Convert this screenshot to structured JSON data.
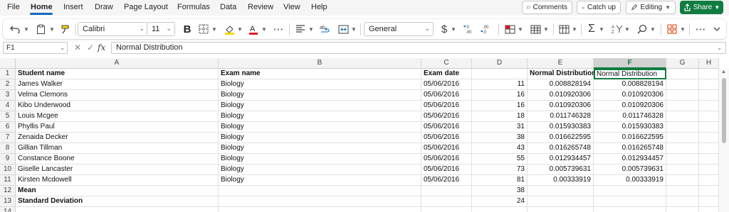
{
  "menu": {
    "items": [
      "File",
      "Home",
      "Insert",
      "Draw",
      "Page Layout",
      "Formulas",
      "Data",
      "Review",
      "View",
      "Help"
    ],
    "active": "Home"
  },
  "top_actions": {
    "comments": "Comments",
    "catch_up": "Catch up",
    "editing": "Editing",
    "share": "Share"
  },
  "ribbon": {
    "font_name": "Calibri",
    "font_size": "11",
    "bold": "B",
    "number_format": "General",
    "currency_symbol": "$",
    "more": "⋯",
    "icons": [
      "undo-icon",
      "paste-icon",
      "format-painter-icon",
      "borders-icon",
      "fill-color-icon",
      "font-color-icon",
      "align-icon",
      "wrap-text-icon",
      "merge-icon",
      "currency-icon",
      "increase-decimal-icon",
      "decrease-decimal-icon",
      "conditional-format-icon",
      "format-as-table-icon",
      "autosum-icon",
      "sort-filter-icon",
      "find-icon",
      "add-ins-icon"
    ],
    "accent_colors": {
      "fill_highlight": "#ffd800",
      "font_color": "#e81123",
      "brand_green": "#107c41"
    }
  },
  "formula_bar": {
    "name_box": "F1",
    "fx": "fx",
    "content": "Normal Distribution"
  },
  "sheet": {
    "columns": [
      "A",
      "B",
      "C",
      "D",
      "E",
      "F",
      "G",
      "H"
    ],
    "selected_column": "F",
    "active_cell": "F1",
    "rows": [
      {
        "n": "1",
        "a": "Student name",
        "b": "Exam name",
        "c": "Exam date",
        "d": "",
        "e": "Normal Distribution",
        "f": "Normal Distribution"
      },
      {
        "n": "2",
        "a": "James Walker",
        "b": "Biology",
        "c": "05/06/2016",
        "d": "11",
        "e": "0.008828194",
        "f": "0.008828194"
      },
      {
        "n": "3",
        "a": "Velma Clemons",
        "b": "Biology",
        "c": "05/06/2016",
        "d": "16",
        "e": "0.010920306",
        "f": "0.010920306"
      },
      {
        "n": "4",
        "a": "Kibo Underwood",
        "b": "Biology",
        "c": "05/06/2016",
        "d": "16",
        "e": "0.010920306",
        "f": "0.010920306"
      },
      {
        "n": "5",
        "a": "Louis Mcgee",
        "b": "Biology",
        "c": "05/06/2016",
        "d": "18",
        "e": "0.011746328",
        "f": "0.011746328"
      },
      {
        "n": "6",
        "a": "Phyllis Paul",
        "b": "Biology",
        "c": "05/06/2016",
        "d": "31",
        "e": "0.015930383",
        "f": "0.015930383"
      },
      {
        "n": "7",
        "a": "Zenaida Decker",
        "b": "Biology",
        "c": "05/06/2016",
        "d": "38",
        "e": "0.016622595",
        "f": "0.016622595"
      },
      {
        "n": "8",
        "a": "Gillian Tillman",
        "b": "Biology",
        "c": "05/06/2016",
        "d": "43",
        "e": "0.016265748",
        "f": "0.016265748"
      },
      {
        "n": "9",
        "a": "Constance Boone",
        "b": "Biology",
        "c": "05/06/2016",
        "d": "55",
        "e": "0.012934457",
        "f": "0.012934457"
      },
      {
        "n": "10",
        "a": "Giselle Lancaster",
        "b": "Biology",
        "c": "05/06/2016",
        "d": "73",
        "e": "0.005739631",
        "f": "0.005739631"
      },
      {
        "n": "11",
        "a": "Kirsten Mcdowell",
        "b": "Biology",
        "c": "05/06/2016",
        "d": "81",
        "e": "0.00333919",
        "f": "0.00333919"
      },
      {
        "n": "12",
        "a": "Mean",
        "b": "",
        "c": "",
        "d": "38",
        "e": "",
        "f": ""
      },
      {
        "n": "13",
        "a": "Standard Deviation",
        "b": "",
        "c": "",
        "d": "24",
        "e": "",
        "f": ""
      },
      {
        "n": "14",
        "a": "",
        "b": "",
        "c": "",
        "d": "",
        "e": "",
        "f": ""
      }
    ]
  }
}
